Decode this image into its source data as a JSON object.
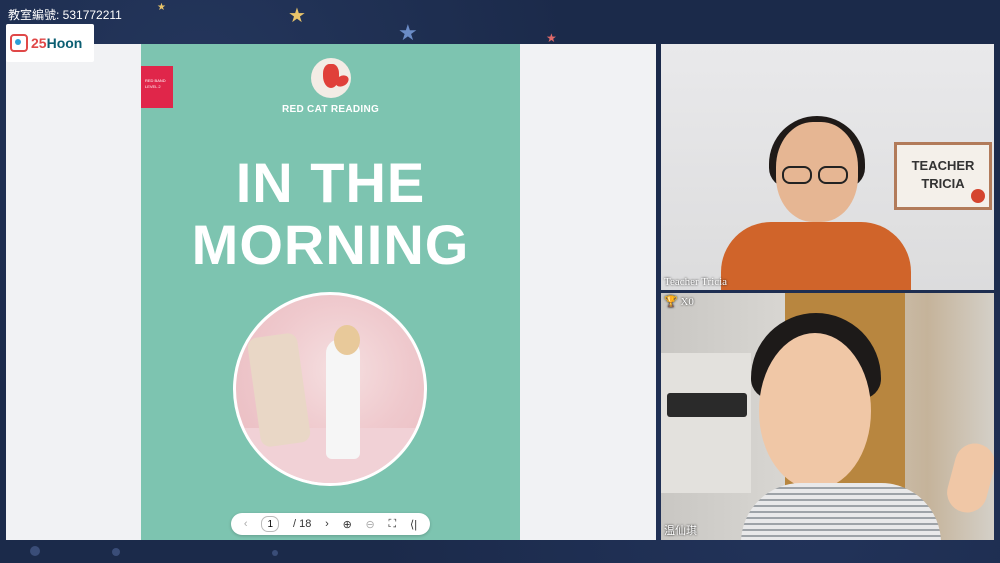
{
  "room": {
    "label": "教室編號: 531772211"
  },
  "logo": {
    "prefix": "25",
    "text": "Hoon"
  },
  "book": {
    "band": "RED BAND\nLEVEL 2",
    "publisher": "RED CAT READING",
    "title_line1": "IN THE",
    "title_line2": "MORNING"
  },
  "viewer": {
    "prev": "‹",
    "page_current": "1",
    "page_total": "/ 18",
    "next": "›",
    "zoom_in": "⊕",
    "zoom_out": "⊖",
    "fullscreen": "⛶",
    "collapse": "⟨|"
  },
  "videos": {
    "teacher": {
      "name": "Teacher Tricia",
      "sign_line1": "TEACHER",
      "sign_line2": "TRICIA"
    },
    "student": {
      "name": "温仙琪",
      "cups": "X0"
    }
  },
  "colors": {
    "book_bg": "#7dc4b0",
    "band": "#e0264a",
    "background": "#1b2a4a"
  }
}
